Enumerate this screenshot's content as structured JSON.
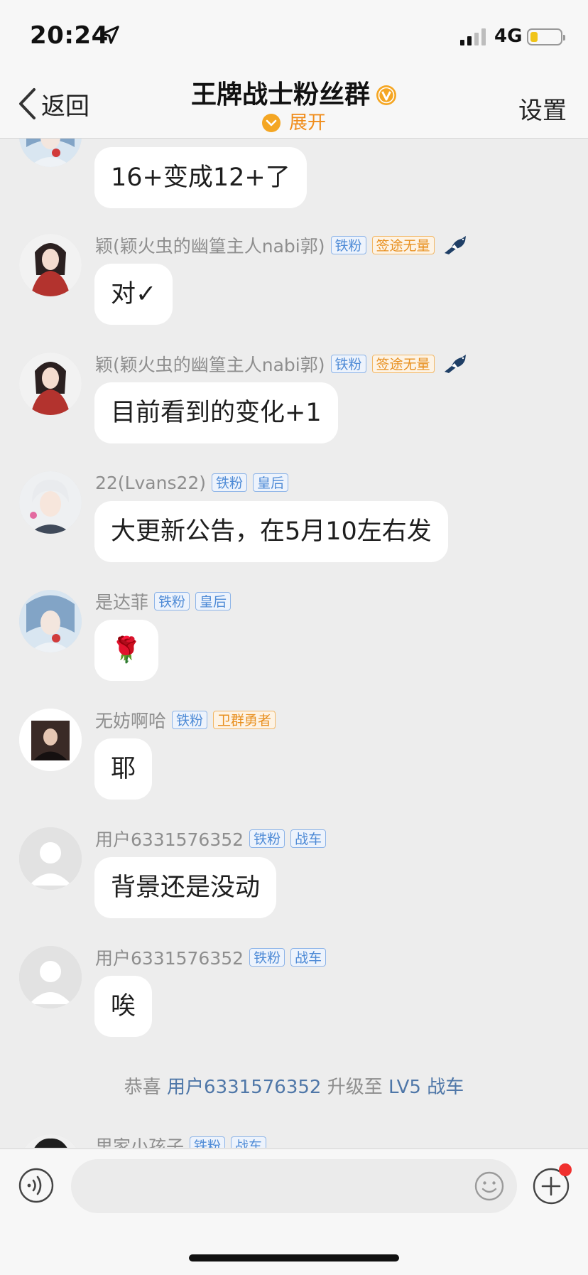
{
  "status_bar": {
    "time": "20:24",
    "network": "4G",
    "battery_level": 0.25
  },
  "header": {
    "back_label": "返回",
    "title": "王牌战士粉丝群",
    "expand_label": "展开",
    "settings_label": "设置"
  },
  "colors": {
    "badge_blue": "#4f8bd6",
    "badge_orange": "#e89020",
    "accent": "#f4a623"
  },
  "messages": [
    {
      "text": "16+变成12+了"
    },
    {
      "sender": "颖(颖火虫的幽篁主人nabi郭)",
      "badges": [
        "铁粉",
        "签途无量"
      ],
      "text": "对✓"
    },
    {
      "sender": "颖(颖火虫的幽篁主人nabi郭)",
      "badges": [
        "铁粉",
        "签途无量"
      ],
      "text": "目前看到的变化+1"
    },
    {
      "sender": "22(Lvans22)",
      "badges": [
        "铁粉",
        "皇后"
      ],
      "text": "大更新公告，在5月10左右发"
    },
    {
      "sender": "是达菲",
      "badges": [
        "铁粉",
        "皇后"
      ],
      "text": "🌹"
    },
    {
      "sender": "无妨啊哈",
      "badges": [
        "铁粉",
        "卫群勇者"
      ],
      "text": "耶"
    },
    {
      "sender": "用户6331576352",
      "badges": [
        "铁粉",
        "战车"
      ],
      "text": "背景还是没动"
    },
    {
      "sender": "用户6331576352",
      "badges": [
        "铁粉",
        "战车"
      ],
      "text": "唉"
    },
    {
      "sender": "里家小孩子",
      "badges": [
        "铁粉",
        "战车"
      ]
    }
  ],
  "system_message": {
    "prefix": "恭喜",
    "user": "用户6331576352",
    "middle": "升级至",
    "level": "LV5 战车"
  },
  "input": {
    "placeholder": ""
  },
  "icons": {
    "back": "chevron-left-icon",
    "vip": "vip-v-icon",
    "expand": "chevron-down-icon",
    "voice": "voice-icon",
    "emoji": "emoji-icon",
    "plus": "plus-icon",
    "bird": "magpie-icon"
  }
}
